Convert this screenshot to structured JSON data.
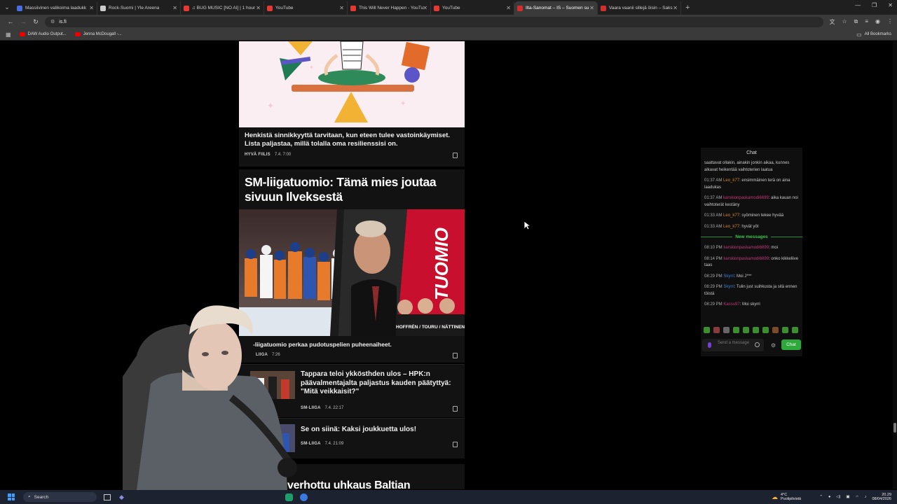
{
  "browser": {
    "tabs": [
      {
        "title": "Massiivinen valikoima laadukk",
        "color": "#4a6ee0"
      },
      {
        "title": "Rock-Suomi | Yle Areena",
        "color": "#cccccc"
      },
      {
        "title": "♫ BUG MUSIC [NO AI] | 1 hour",
        "color": "#e53935"
      },
      {
        "title": "YouTube",
        "color": "#e53935"
      },
      {
        "title": "This Will Never Happen - YouTu",
        "color": "#e53935"
      },
      {
        "title": "YouTube",
        "color": "#e53935"
      },
      {
        "title": "Ilta-Sanomat – IS – Suomen su",
        "color": "#d32f2f",
        "active": true
      },
      {
        "title": "Vaara vaanii sillejä öisin – Saks",
        "color": "#d32f2f"
      }
    ],
    "url": "is.fi",
    "bookmarks": [
      "DAW Audio Output...",
      "Jenna McDougall -..."
    ],
    "all_bookmarks_label": "All Bookmarks"
  },
  "articles": {
    "wellness": {
      "caption": "Henkistä sinnikkyyttä tarvitaan, kun eteen tulee vastoinkäymiset. Lista paljastaa, millä tolalla oma resilienssisi on.",
      "section": "HYVÄ FIILIS",
      "time": "7.4. 7:00"
    },
    "liiga": {
      "title": "SM-liigatuomio: Tämä mies joutaa sivuun Ilveksestä",
      "image_text": "TUOMIO",
      "image_names": "HOFFRÉN / TOURU / NÄTTINEN",
      "caption": "-liigatuomio perkaa pudotuspelien puheenaiheet.",
      "section": "LIIGA",
      "time": "7:26"
    },
    "tappara": {
      "title": "Tappara teloi ykkösthden ulos – HPK:n päävalmentajalta paljastus kauden päätyttyä: \"Mitä veikkaisit?\"",
      "section": "SM-LIIGA",
      "time": "7.4. 22:17"
    },
    "siina": {
      "title": "Se on siinä: Kaksi joukkuetta ulos!",
      "section": "SM-LIIGA",
      "time": "7.4. 21:09"
    },
    "next_title": "...voalta verhottu uhkaus Baltian"
  },
  "chat": {
    "title": "Chat",
    "messages": [
      {
        "time": "",
        "user": "",
        "text": "saattavat ollakin, ainakin jonkin aikaa, kunnes alkavat heikentää vaihtoterien laatua",
        "color": "o"
      },
      {
        "time": "01:37 AM",
        "user": "Leo_k77",
        "text": ": ensimmäinen terä on aina laadukas",
        "color": "o"
      },
      {
        "time": "01:37 AM",
        "user": "karskionpaskamodi6699",
        "text": ": aika kauan noi vaihtoterät kestäny",
        "color": "p"
      },
      {
        "time": "01:33 AM",
        "user": "Leo_k77",
        "text": ": syöminen tekee hyvää",
        "color": "o"
      },
      {
        "time": "01:33 AM",
        "user": "Leo_k77",
        "text": ": hyvät yöt",
        "color": "o"
      }
    ],
    "new_messages_label": "New messages",
    "new_messages": [
      {
        "time": "08:10 PM",
        "user": "karskionpaskamodi6699",
        "text": ": moi",
        "color": "p"
      },
      {
        "time": "08:14 PM",
        "user": "karskionpaskamodi6699",
        "text": ": onko kikkeliive taas",
        "color": "p"
      },
      {
        "time": "08:29 PM",
        "user": "Skyrri",
        "text": ": Moi J***",
        "color": "b"
      },
      {
        "time": "08:29 PM",
        "user": "Skyrri",
        "text": ": Tulin just suihkusta ja sitä ennen töistä",
        "color": "b"
      },
      {
        "time": "08:29 PM",
        "user": "Kassu97",
        "text": ": Moi skyrri",
        "color": "p"
      }
    ],
    "input_placeholder": "Send a message",
    "send_label": "Chat"
  },
  "taskbar": {
    "search_label": "Search",
    "weather_temp": "4°C",
    "weather_text": "Puolipilvistä",
    "time": "20.29",
    "date": "08/04/2026"
  }
}
